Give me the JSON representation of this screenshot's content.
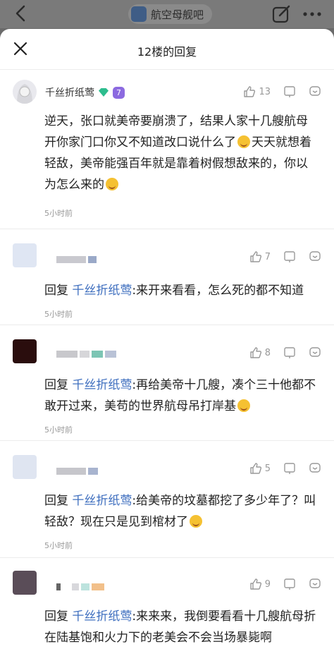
{
  "forum": {
    "name": "航空母舰吧"
  },
  "sheet": {
    "title": "12楼的回复"
  },
  "main_post": {
    "username": "千丝折纸莺",
    "level_badge": "7",
    "likes": "13",
    "text_parts": [
      "逆天，张口就美帝要崩溃了，结果人家十几艘航母开你家门口你又不知道改口说什么了",
      "天天就想着轻敌，美帝能强百年就是靠着树假想敌来的，你以为怎么来的"
    ],
    "time": "5小时前"
  },
  "replies": [
    {
      "likes": "7",
      "reply_word": "回复",
      "mention": "千丝折纸莺",
      "text": ":来开来看看，怎么死的都不知道",
      "time": "5小时前"
    },
    {
      "likes": "8",
      "reply_word": "回复",
      "mention": "千丝折纸莺",
      "text": ":再给美帝十几艘，凑个三十他都不敢开过来，美苟的世界航母吊打岸基",
      "time": "5小时前"
    },
    {
      "likes": "5",
      "reply_word": "回复",
      "mention": "千丝折纸莺",
      "text": ":给美帝的坟墓都挖了多少年了？叫轻敌？现在只是见到棺材了",
      "time": "5小时前"
    },
    {
      "likes": "9",
      "reply_word": "回复",
      "mention": "千丝折纸莺",
      "text": ":来来来，我倒要看看十几艘航母折在陆基饱和火力下的老美会不会当场暴毙啊",
      "time": ""
    }
  ],
  "icons": {
    "back": "back-arrow-icon",
    "edit": "edit-icon",
    "more": "more-icon",
    "close": "close-icon",
    "like": "thumbs-up-icon",
    "dislike": "thumbs-down-icon",
    "comment": "comment-icon"
  },
  "colors": {
    "mention": "#3f6fbf",
    "meta": "#999999"
  }
}
